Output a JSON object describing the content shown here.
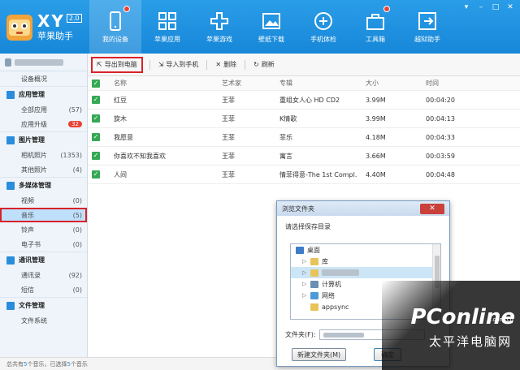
{
  "app": {
    "brand": "XY",
    "version": "2.0",
    "subtitle": "苹果助手",
    "nav": [
      {
        "label": "我的设备",
        "icon": "device-icon",
        "active": true,
        "dot": true
      },
      {
        "label": "苹果应用",
        "icon": "apps-grid-icon"
      },
      {
        "label": "苹果游戏",
        "icon": "gamepad-icon"
      },
      {
        "label": "壁纸下载",
        "icon": "picture-icon"
      },
      {
        "label": "手机体检",
        "icon": "checkup-icon"
      },
      {
        "label": "工具箱",
        "icon": "toolbox-icon",
        "dot": true
      },
      {
        "label": "越狱助手",
        "icon": "jailbreak-icon"
      }
    ]
  },
  "sidebar": {
    "overview": "设备概况",
    "groups": [
      {
        "title": "应用管理",
        "items": [
          {
            "label": "全部应用",
            "count": "(57)"
          },
          {
            "label": "应用升级",
            "badge": "32"
          }
        ]
      },
      {
        "title": "图片管理",
        "items": [
          {
            "label": "相机照片",
            "count": "(1353)"
          },
          {
            "label": "其他照片",
            "count": "(4)"
          }
        ]
      },
      {
        "title": "多媒体管理",
        "items": [
          {
            "label": "视频",
            "count": "(0)"
          },
          {
            "label": "音乐",
            "count": "(5)",
            "selected": true
          },
          {
            "label": "铃声",
            "count": "(0)"
          },
          {
            "label": "电子书",
            "count": "(0)"
          }
        ]
      },
      {
        "title": "通讯管理",
        "items": [
          {
            "label": "通讯录",
            "count": "(92)"
          },
          {
            "label": "短信",
            "count": "(0)"
          }
        ]
      },
      {
        "title": "文件管理",
        "items": [
          {
            "label": "文件系统",
            "count": ""
          }
        ]
      }
    ]
  },
  "toolbar": {
    "export_pc": "导出到电脑",
    "import_phone": "导入到手机",
    "delete": "删除",
    "refresh": "刷新"
  },
  "table": {
    "headers": {
      "name": "名称",
      "artist": "艺术家",
      "album": "专辑",
      "size": "大小",
      "time": "时间"
    },
    "rows": [
      {
        "name": "红豆",
        "artist": "王菲",
        "album": "重组女人心 HD CD2",
        "size": "3.99M",
        "time": "00:04:20"
      },
      {
        "name": "旋木",
        "artist": "王菲",
        "album": "K情歌",
        "size": "3.99M",
        "time": "00:04:13"
      },
      {
        "name": "我愿意",
        "artist": "王菲",
        "album": "菲乐",
        "size": "4.18M",
        "time": "00:04:33"
      },
      {
        "name": "你喜欢不知我喜欢",
        "artist": "王菲",
        "album": "寓言",
        "size": "3.66M",
        "time": "00:03:59"
      },
      {
        "name": "人间",
        "artist": "王菲",
        "album": "情菲得意-The 1st Compl.",
        "size": "4.40M",
        "time": "00:04:48"
      }
    ]
  },
  "status": {
    "prefix": "总共有",
    "total": "5",
    "middle": "个音乐，已选择",
    "selected": "5",
    "suffix": "个音乐"
  },
  "dialog": {
    "title": "浏览文件夹",
    "close": "✕",
    "prompt": "请选择保存目录",
    "tree": [
      {
        "label": "桌面",
        "level": 0,
        "icon": "desktop-icon"
      },
      {
        "label": "库",
        "level": 1,
        "icon": "library-icon"
      },
      {
        "label": "",
        "level": 1,
        "icon": "user-folder-icon",
        "blurred": true
      },
      {
        "label": "计算机",
        "level": 1,
        "icon": "computer-icon"
      },
      {
        "label": "网络",
        "level": 1,
        "icon": "network-icon"
      },
      {
        "label": "appsync",
        "level": 1,
        "icon": "folder-icon"
      }
    ],
    "folder_label": "文件夹(F):",
    "new_folder": "新建文件夹(M)",
    "ok": "确定"
  },
  "watermark": {
    "logo": "PConline",
    "domain": ".com.cn",
    "sub": "太平洋电脑网"
  },
  "colors": {
    "header": "#1f93e2",
    "accent_red": "#d9222a",
    "check_green": "#35a854",
    "sidebar_bg": "#eef4fa"
  }
}
